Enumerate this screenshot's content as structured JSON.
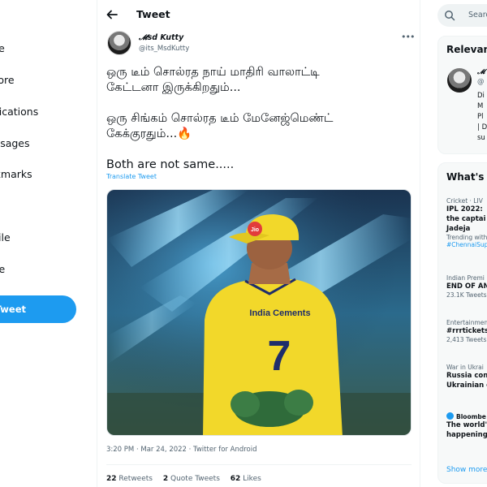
{
  "nav": {
    "items": [
      {
        "label": "me"
      },
      {
        "label": "plore"
      },
      {
        "label": "tifications"
      },
      {
        "label": "essages"
      },
      {
        "label": "okmarks"
      },
      {
        "label": "ts"
      },
      {
        "label": "ofile"
      },
      {
        "label": "ore"
      }
    ],
    "tweet_button": "Tweet"
  },
  "header": {
    "title": "Tweet"
  },
  "tweet": {
    "display_name": "𝓜sd Kutty",
    "handle": "@its_MsdKutty",
    "text": "ஒரு டீம் சொல்ரத நாய் மாதிரி வாலாட்டி\nகேட்டனா இருக்கிறதும்...\n\nஒரு சிங்கம் சொல்ரத  டீம் மேனேஜ்மெண்ட்\nகேக்குரதும்...🔥\n\nBoth are not same.....",
    "translate": "Translate Tweet",
    "image": {
      "jersey_text": "India Cements",
      "number": "7",
      "cap_logo": "Jio"
    },
    "timestamp": "3:20 PM · Mar 24, 2022 · Twitter for Android",
    "stats": {
      "retweets_count": "22",
      "retweets_label": "Retweets",
      "quotes_count": "2",
      "quotes_label": "Quote Tweets",
      "likes_count": "62",
      "likes_label": "Likes"
    }
  },
  "search": {
    "placeholder": "Searc"
  },
  "relevant": {
    "title": "Relevan",
    "name": "𝓜",
    "handle": "@",
    "bio_lines": [
      "Di",
      "M",
      "Pl",
      "| D",
      "su"
    ]
  },
  "trends": {
    "title": "What's",
    "items": [
      {
        "meta": "Cricket · LIV",
        "title_lines": [
          "IPL 2022: ",
          "the captai",
          "Jadeja"
        ],
        "sub": "Trending with",
        "tag": "#ChennaiSup"
      },
      {
        "meta": "Indian Premi",
        "title_lines": [
          "END OF AN"
        ],
        "sub": "23.1K Tweets"
      },
      {
        "meta": "Entertainmen",
        "title_lines": [
          "#rrrtickets"
        ],
        "sub": "2,413 Tweets"
      },
      {
        "meta": "War in Ukrai",
        "title_lines": [
          "Russia con",
          "Ukrainian c"
        ]
      },
      {
        "meta": "Bloombe",
        "title_lines": [
          "The world'",
          "happening"
        ]
      }
    ],
    "show_more": "Show more"
  },
  "colors": {
    "accent": "#1d9bf0",
    "jersey": "#f2d82a",
    "jersey_text": "#1f2d6b",
    "glove": "#2f6b3a"
  }
}
